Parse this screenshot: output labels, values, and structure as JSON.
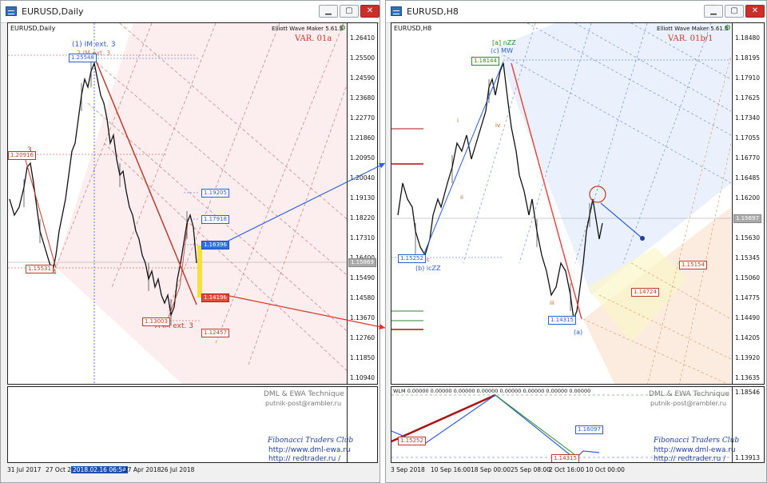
{
  "left": {
    "window_title": "EURUSD,Daily",
    "chart_symbol": "EURUSD,Daily",
    "maker": "Elliott Wave Maker 5.61.5",
    "variant": "VAR. 01a",
    "top_label": "(1) IM ext. 3",
    "top_label2": "2 IM ext. 3",
    "bottom_label": "A IM ext. 3",
    "wave3": "3",
    "wave4": "4",
    "axis_prices": [
      "1.26410",
      "1.25500",
      "1.24590",
      "1.23680",
      "1.22770",
      "1.21860",
      "1.20950",
      "1.20040",
      "1.19130",
      "1.18220",
      "1.17310",
      "1.16400",
      "1.15490",
      "1.14580",
      "1.13670",
      "1.12760",
      "1.11850",
      "1.10940"
    ],
    "current_price": "1.15869",
    "boxes": {
      "top": "1.25548",
      "b1": "1.19205",
      "b2": "1.17918",
      "b3": "1.16396",
      "r1": "1.14196",
      "r2": "1.12457",
      "low": "1.13003",
      "left4": "1.15531",
      "left3": "1.20916"
    },
    "sub_title1": "DML & EWA Technique",
    "sub_title2": "putnik-post@rambler.ru",
    "club": "Fibonacci  Traders  Club",
    "url1": "http://www.dml-ewa.ru",
    "url2": "http:// redtrader.ru /",
    "dates": [
      "31 Jul 2017",
      "27 Oct 2017",
      "2018.02.16 06:54",
      "27 Apr 2018",
      "26 Jul 2018"
    ]
  },
  "right": {
    "window_title": "EURUSD,H8",
    "chart_symbol": "EURUSD,H8",
    "maker": "Elliott Wave Maker 5.61.5",
    "variant": "VAR. 01b/1",
    "label_nzz": "[a] nZZ",
    "label_mw": "(c) MW",
    "label_iczz": "(b) icZZ",
    "label_a": "(a)",
    "label_c": "c",
    "label_ii": "ii",
    "label_iii": "iii",
    "label_iv": "iv",
    "label_i": "i",
    "axis_prices": [
      "1.18480",
      "1.18195",
      "1.17910",
      "1.17625",
      "1.17340",
      "1.17055",
      "1.16770",
      "1.16485",
      "1.16200",
      "1.15915",
      "1.15630",
      "1.15345",
      "1.15060",
      "1.14775",
      "1.14490",
      "1.14205",
      "1.13920",
      "1.13635"
    ],
    "current_price": "1.15697",
    "boxes": {
      "top": "1.18144",
      "left": "1.15252",
      "low": "1.14315",
      "r1": "1.15154",
      "r2": "1.14724"
    },
    "wlm": "WLM 0.00000 0.00000 0.00000 0.00000 0.00000 0.00000 0.00000 0.00000",
    "sub_title1": "DML & EWA Technique",
    "sub_title2": "putnik-post@rambler.ru",
    "club": "Fibonacci  Traders  Club",
    "url1": "http://www.dml-ewa.ru",
    "url2": "http:// redtrader.ru /",
    "sub_axis_top": "1.18546",
    "sub_axis_bottom": "1.13913",
    "sub_boxes": {
      "a": "1.15252",
      "b": "1.16097",
      "c": "1.14315"
    },
    "dates": [
      "3 Sep 2018",
      "10 Sep 16:00",
      "18 Sep 00:00",
      "25 Sep 08:00",
      "2 Oct 16:00",
      "10 Oct 00:00"
    ]
  },
  "colors": {
    "red": "#c0392b",
    "blue": "#2f5fd0",
    "brown": "#8b5a2b"
  }
}
